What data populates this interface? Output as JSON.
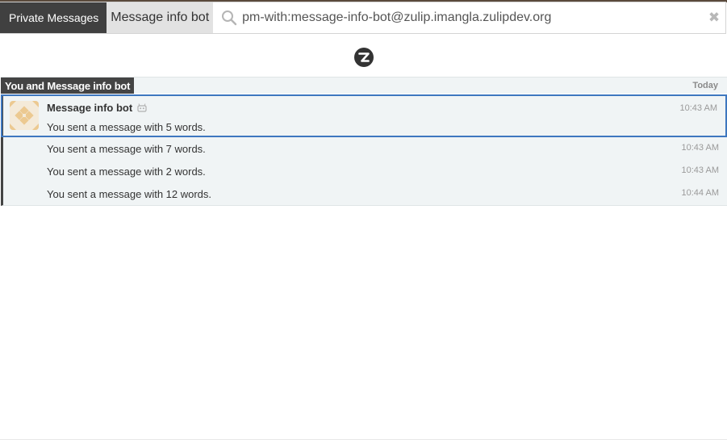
{
  "narrow": {
    "filters": [
      "Private Messages",
      "Message info bot"
    ],
    "query": "pm-with:message-info-bot@zulip.imangla.zulipdev.org",
    "clear_icon": "close-icon",
    "search_icon": "search-icon"
  },
  "recipient": {
    "label": "You and Message info bot",
    "date": "Today"
  },
  "messages": [
    {
      "sender": "Message info bot",
      "is_bot": true,
      "content": "You sent a message with 5 words.",
      "time": "10:43 AM",
      "selected": true
    },
    {
      "content": "You sent a message with 7 words.",
      "time": "10:43 AM"
    },
    {
      "content": "You sent a message with 2 words.",
      "time": "10:43 AM"
    },
    {
      "content": "You sent a message with 12 words.",
      "time": "10:44 AM"
    }
  ],
  "colors": {
    "selected_border": "#3e77bf",
    "recipient_label_bg": "#444444",
    "message_bg": "#f0f4f5",
    "avatar_bg": "#f4ead9",
    "avatar_pattern": "#ecc991"
  }
}
